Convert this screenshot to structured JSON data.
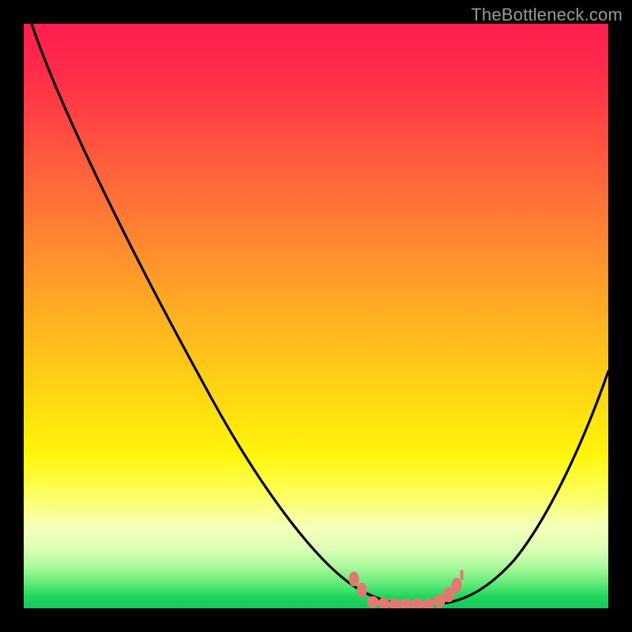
{
  "watermark": {
    "text": "TheBottleneck.com"
  },
  "chart_data": {
    "type": "line",
    "title": "",
    "xlabel": "",
    "ylabel": "",
    "xlim": [
      0,
      100
    ],
    "ylim": [
      0,
      100
    ],
    "series": [
      {
        "name": "bottleneck-curve",
        "x": [
          0,
          10,
          20,
          30,
          40,
          48,
          52,
          55,
          58,
          62,
          66,
          70,
          75,
          80,
          85,
          90,
          95,
          100
        ],
        "values": [
          100,
          86,
          72,
          57,
          42,
          28,
          18,
          10,
          4,
          1,
          0,
          0,
          2,
          8,
          16,
          26,
          38,
          52
        ]
      }
    ],
    "annotations": [
      {
        "name": "optimal-region-dots",
        "x_start": 55,
        "x_end": 72,
        "y": 1
      }
    ],
    "gradient_note": "background encodes bottleneck severity: red=high, green=optimal"
  }
}
